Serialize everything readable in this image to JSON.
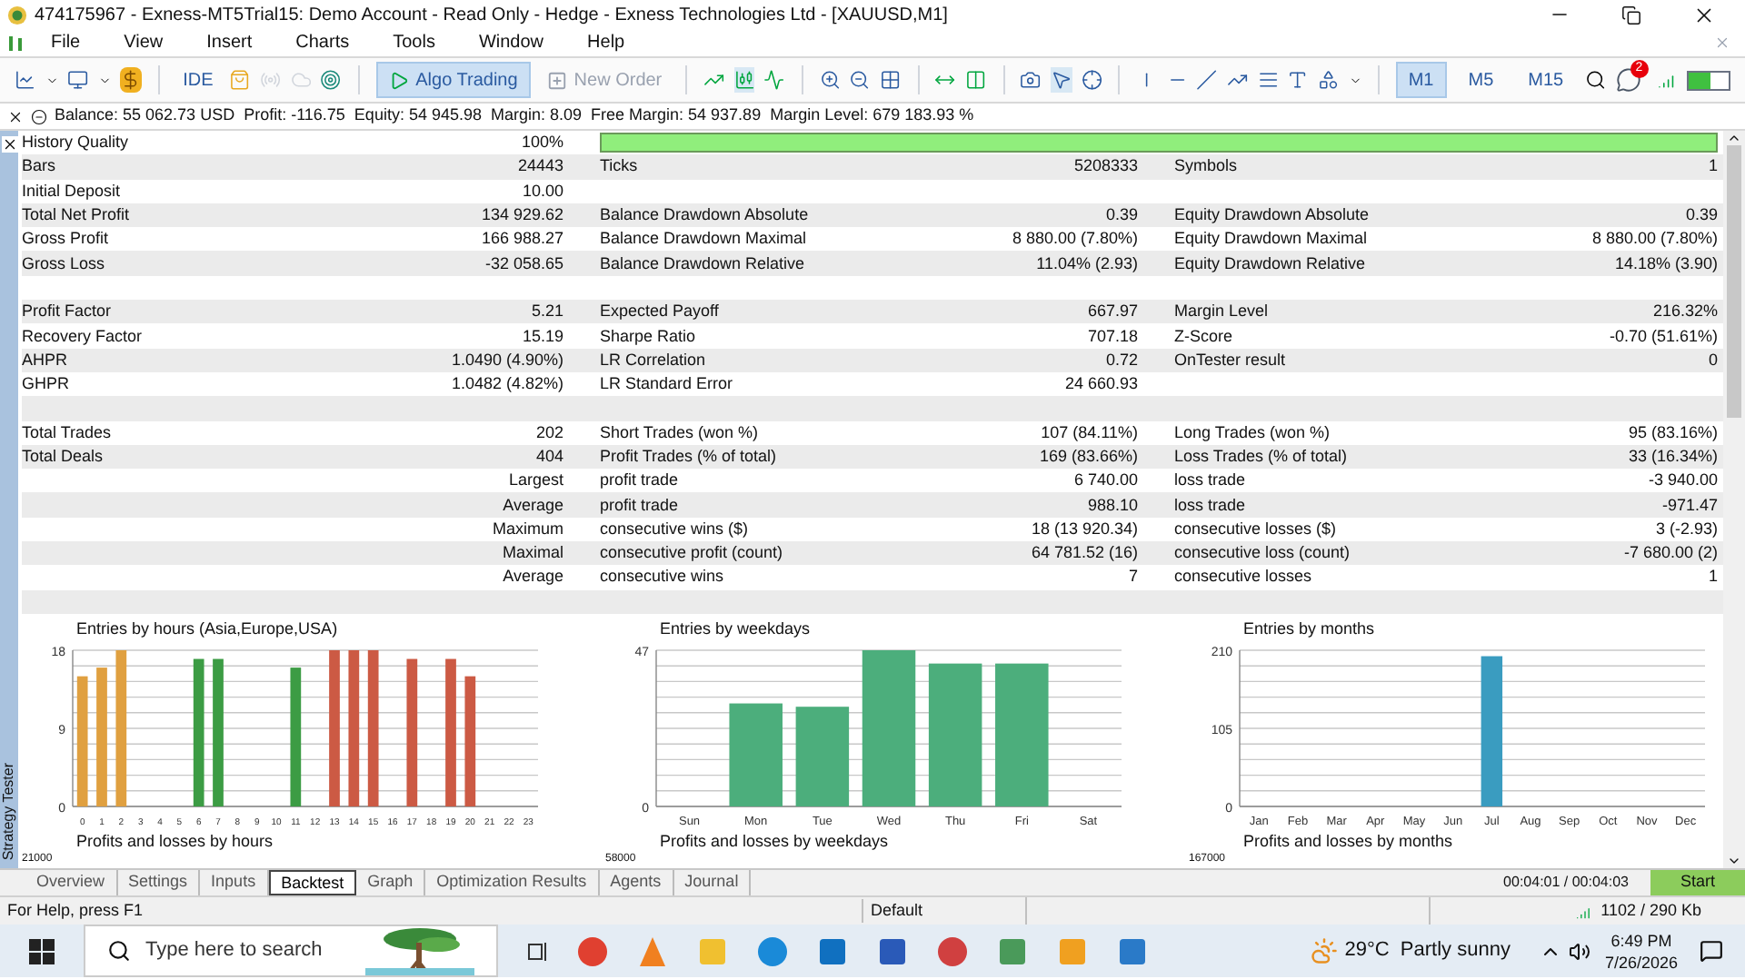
{
  "window": {
    "title": "474175967 - Exness-MT5Trial15: Demo Account - Read Only - Hedge - Exness Technologies Ltd - [XAUUSD,M1]"
  },
  "menu": [
    "File",
    "View",
    "Insert",
    "Charts",
    "Tools",
    "Window",
    "Help"
  ],
  "toolbar": {
    "ide": "IDE",
    "algo_trading": {
      "label": "Algo Trading",
      "selected": true
    },
    "new_order": {
      "label": "New Order",
      "disabled": true
    },
    "timeframes": [
      {
        "label": "M1",
        "selected": true
      },
      {
        "label": "M5",
        "selected": false
      },
      {
        "label": "M15",
        "selected": false
      }
    ],
    "notification_count": "2"
  },
  "account_bar": "Balance: 55 062.73 USD  Profit: -116.75  Equity: 54 945.98  Margin: 8.09  Free Margin: 54 937.89  Margin Level: 679 183.93 %",
  "report": [
    {
      "kind": "quality",
      "label_1": "History Quality",
      "value_1": "100%",
      "level": 1
    },
    {
      "label_1": "Bars",
      "value_1": "24443",
      "label_2": "Ticks",
      "value_2": "5208333",
      "label_3": "Symbols",
      "value_3": "1"
    },
    {
      "label_1": "Initial Deposit",
      "value_1": "10.00"
    },
    {
      "label_1": "Total Net Profit",
      "value_1": "134 929.62",
      "label_2": "Balance Drawdown Absolute",
      "value_2": "0.39",
      "label_3": "Equity Drawdown Absolute",
      "value_3": "0.39"
    },
    {
      "label_1": "Gross Profit",
      "value_1": "166 988.27",
      "label_2": "Balance Drawdown Maximal",
      "value_2": "8 880.00 (7.80%)",
      "label_3": "Equity Drawdown Maximal",
      "value_3": "8 880.00 (7.80%)"
    },
    {
      "label_1": "Gross Loss",
      "value_1": "-32 058.65",
      "label_2": "Balance Drawdown Relative",
      "value_2": "11.04% (2.93)",
      "label_3": "Equity Drawdown Relative",
      "value_3": "14.18% (3.90)"
    },
    {
      "kind": "blank"
    },
    {
      "label_1": "Profit Factor",
      "value_1": "5.21",
      "label_2": "Expected Payoff",
      "value_2": "667.97",
      "label_3": "Margin Level",
      "value_3": "216.32%"
    },
    {
      "label_1": "Recovery Factor",
      "value_1": "15.19",
      "label_2": "Sharpe Ratio",
      "value_2": "707.18",
      "label_3": "Z-Score",
      "value_3": "-0.70 (51.61%)"
    },
    {
      "label_1": "AHPR",
      "value_1": "1.0490 (4.90%)",
      "label_2": "LR Correlation",
      "value_2": "0.72",
      "label_3": "OnTester result",
      "value_3": "0"
    },
    {
      "label_1": "GHPR",
      "value_1": "1.0482 (4.82%)",
      "label_2": "LR Standard Error",
      "value_2": "24 660.93"
    },
    {
      "kind": "blank"
    },
    {
      "label_1": "Total Trades",
      "value_1": "202",
      "label_2": "Short Trades (won %)",
      "value_2": "107 (84.11%)",
      "label_3": "Long Trades (won %)",
      "value_3": "95 (83.16%)"
    },
    {
      "label_1": "Total Deals",
      "value_1": "404",
      "label_2": "Profit Trades (% of total)",
      "value_2": "169 (83.66%)",
      "label_3": "Loss Trades (% of total)",
      "value_3": "33 (16.34%)"
    },
    {
      "value_1": "Largest",
      "label_2": "profit trade",
      "value_2": "6 740.00",
      "label_3": "loss trade",
      "value_3": "-3 940.00"
    },
    {
      "value_1": "Average",
      "label_2": "profit trade",
      "value_2": "988.10",
      "label_3": "loss trade",
      "value_3": "-971.47"
    },
    {
      "value_1": "Maximum",
      "label_2": "consecutive wins ($)",
      "value_2": "18 (13 920.34)",
      "label_3": "consecutive losses ($)",
      "value_3": "3 (-2.93)"
    },
    {
      "value_1": "Maximal",
      "label_2": "consecutive profit (count)",
      "value_2": "64 781.52 (16)",
      "label_3": "consecutive loss (count)",
      "value_3": "-7 680.00 (2)"
    },
    {
      "value_1": "Average",
      "label_2": "consecutive wins",
      "value_2": "7",
      "label_3": "consecutive losses",
      "value_3": "1"
    },
    {
      "kind": "blank"
    }
  ],
  "charts": [
    {
      "chart_data": {
        "type": "bar",
        "title": "Entries by hours (Asia,Europe,USA)",
        "categories": [
          "0",
          "1",
          "2",
          "3",
          "4",
          "5",
          "6",
          "7",
          "8",
          "9",
          "10",
          "11",
          "12",
          "13",
          "14",
          "15",
          "16",
          "17",
          "18",
          "19",
          "20",
          "21",
          "22",
          "23"
        ],
        "stacked": true,
        "ylim": [
          0,
          18
        ],
        "yticks": [
          0,
          9,
          18
        ],
        "series": [
          {
            "color": "#e0a040",
            "values": [
              15,
              16,
              18,
              null,
              null,
              null,
              null,
              null,
              null,
              null,
              null,
              null,
              null,
              null,
              null,
              null,
              null,
              null,
              null,
              null,
              null,
              null,
              null,
              null
            ]
          },
          {
            "color": "#3c9c44",
            "values": [
              null,
              null,
              null,
              null,
              null,
              null,
              17,
              17,
              null,
              null,
              null,
              16,
              null,
              null,
              null,
              null,
              null,
              null,
              null,
              null,
              null,
              null,
              null,
              null
            ]
          },
          {
            "color": "#cc5a44",
            "values": [
              null,
              null,
              null,
              null,
              null,
              null,
              null,
              null,
              null,
              null,
              null,
              null,
              null,
              18,
              18,
              18,
              null,
              17,
              null,
              17,
              15,
              null,
              null,
              null
            ]
          }
        ]
      }
    },
    {
      "chart_data": {
        "type": "bar",
        "title": "Entries by weekdays",
        "categories": [
          "Sun",
          "Mon",
          "Tue",
          "Wed",
          "Thu",
          "Fri",
          "Sat"
        ],
        "ylim": [
          0,
          47
        ],
        "yticks": [
          0,
          47
        ],
        "series": [
          {
            "color": "#4cae7c",
            "values": [
              0,
              31,
              30,
              47,
              43,
              43,
              0
            ]
          }
        ]
      }
    },
    {
      "chart_data": {
        "type": "bar",
        "title": "Entries by months",
        "categories": [
          "Jan",
          "Feb",
          "Mar",
          "Apr",
          "May",
          "Jun",
          "Jul",
          "Aug",
          "Sep",
          "Oct",
          "Nov",
          "Dec"
        ],
        "ylim": [
          0,
          210
        ],
        "yticks": [
          0,
          105,
          210
        ],
        "series": [
          {
            "color": "#3a9cc0",
            "values": [
              0,
              0,
              0,
              0,
              0,
              0,
              202,
              0,
              0,
              0,
              0,
              0
            ]
          }
        ]
      }
    }
  ],
  "lower_charts": [
    {
      "title": "Profits and losses by hours",
      "top_tick": "21000"
    },
    {
      "title": "Profits and losses by weekdays",
      "top_tick": "58000"
    },
    {
      "title": "Profits and losses by months",
      "top_tick": "167000"
    }
  ],
  "side_label": "Strategy Tester",
  "tester_tabs": [
    {
      "label": "Overview",
      "selected": false
    },
    {
      "label": "Settings",
      "selected": false
    },
    {
      "label": "Inputs",
      "selected": false
    },
    {
      "label": "Backtest",
      "selected": true
    },
    {
      "label": "Graph",
      "selected": false
    },
    {
      "label": "Optimization Results",
      "selected": false
    },
    {
      "label": "Agents",
      "selected": false
    },
    {
      "label": "Journal",
      "selected": false
    }
  ],
  "timer": "00:04:01 / 00:04:03",
  "start_button": "Start",
  "status_bar": {
    "help": "For Help, press F1",
    "profile": "Default",
    "traffic": "1102 / 290 Kb"
  },
  "taskbar": {
    "search_placeholder": "Type here to search",
    "weather": "29°C  Partly sunny",
    "time": "6:49 PM",
    "date": "7/26/2026"
  }
}
